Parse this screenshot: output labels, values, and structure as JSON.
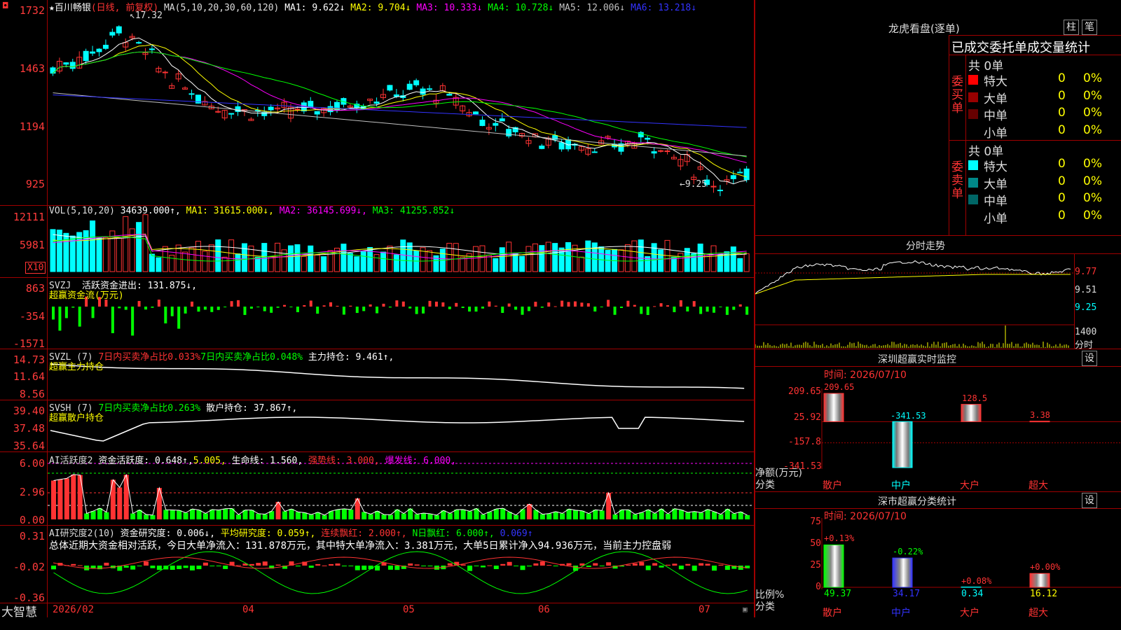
{
  "stock": {
    "star": "★",
    "name": "百川畅银",
    "mode": "(日线, 前复权)"
  },
  "kline": {
    "ma_title": "MA(5,10,20,30,60,120)",
    "ma_items": [
      {
        "label": "MA1: 9.622↓",
        "color": "#ffffff"
      },
      {
        "label": "MA2: 9.704↓",
        "color": "#ffff00"
      },
      {
        "label": "MA3: 10.333↓",
        "color": "#ff00ff"
      },
      {
        "label": "MA4: 10.728↓",
        "color": "#00ff00"
      },
      {
        "label": "MA5: 12.006↓",
        "color": "#c0c0c0"
      },
      {
        "label": "MA6: 13.218↓",
        "color": "#3333ff"
      }
    ],
    "y_labels": [
      "1732",
      "1463",
      "1194",
      "925"
    ],
    "high_mark": "17.32",
    "low_mark": "←9.25",
    "colors": {
      "up": "#ff3333",
      "down": "#00ffff"
    }
  },
  "vol": {
    "title": "VOL(5,10,20)",
    "value": "34639.000↑,",
    "ma1": "MA1: 31615.000↓,",
    "ma2": "MA2: 36145.699↓,",
    "ma3": "MA3: 41255.852↓",
    "y_labels": [
      "12111",
      "5981"
    ],
    "unit": "X10"
  },
  "svzj": {
    "title": "SVZJ",
    "desc": "活跃资金进出: 131.875↓,",
    "sub": "超赢资金流(万元)",
    "y_labels": [
      "863",
      "-354",
      "-1571"
    ]
  },
  "svzl": {
    "title": "SVZL (7)",
    "t1": "7日内买卖净占比0.033%",
    "t2": "7日内买卖净占比0.048%",
    "t3": "主力持仓: 9.461↑,",
    "sub": "超赢主力持仓",
    "y_labels": [
      "14.73",
      "11.64",
      "8.56"
    ]
  },
  "svsh": {
    "title": "SVSH (7)",
    "t1": "7日内买卖净占比0.263%",
    "t2": "散户持仓: 37.867↑,",
    "sub": "超赢散户持仓",
    "y_labels": [
      "39.40",
      "37.48",
      "35.64"
    ]
  },
  "ai1": {
    "title": "AI活跃度2",
    "t1": "资金活跃度: 0.648↑,",
    "t2": "5.005,",
    "t3": "生命线: 1.560,",
    "t4": "强势线: 3.000,",
    "t5": "爆发线: 6.000,",
    "y_labels": [
      "6.00",
      "2.96",
      "0.00"
    ]
  },
  "ai2": {
    "title": "AI研究度2(10)",
    "t1": "资金研究度: 0.006↓,",
    "t2": "平均研究度: 0.059↑,",
    "t3": "连续飘红: 2.000↑,",
    "t4": "N日飘红: 6.000↑,",
    "t5": "0.069↑",
    "summary": "总体近期大资金相对活跃，今日大单净流入：131.878万元，其中特大单净流入：3.381万元，大单5日累计净入94.936万元，当前主力控盘弱",
    "y_labels": [
      "0.31",
      "-0.02",
      "-0.36"
    ]
  },
  "xaxis": {
    "labels": [
      "2026/02",
      "04",
      "05",
      "06",
      "07"
    ],
    "logo": "大智慧"
  },
  "lhb": {
    "title": "龙虎看盘(逐单)",
    "tab1": "柱",
    "tab2": "笔",
    "header": "已成交委托单成交量统计",
    "buy": {
      "side": "委买单",
      "total": "共 0单",
      "rows": [
        {
          "name": "特大",
          "count": "0",
          "pct": "0%",
          "color": "#ff0000"
        },
        {
          "name": "大单",
          "count": "0",
          "pct": "0%",
          "color": "#990000"
        },
        {
          "name": "中单",
          "count": "0",
          "pct": "0%",
          "color": "#660000"
        },
        {
          "name": "小单",
          "count": "0",
          "pct": "0%",
          "color": "#000000"
        }
      ]
    },
    "sell": {
      "side": "委卖单",
      "total": "共 0单",
      "rows": [
        {
          "name": "特大",
          "count": "0",
          "pct": "0%",
          "color": "#00ffff"
        },
        {
          "name": "大单",
          "count": "0",
          "pct": "0%",
          "color": "#008888"
        },
        {
          "name": "中单",
          "count": "0",
          "pct": "0%",
          "color": "#006666"
        },
        {
          "name": "小单",
          "count": "0",
          "pct": "0%",
          "color": "#000000"
        }
      ]
    }
  },
  "fenshi": {
    "title": "分时走势",
    "y_labels": [
      "9.77",
      "9.51",
      "9.25"
    ],
    "vol_label": "1400",
    "unit_label": "分时"
  },
  "monitor": {
    "title": "深圳超赢实时监控",
    "set": "设",
    "time": "时间: 2026/07/10",
    "y_labels": [
      "209.65",
      "25.92",
      "-157.8",
      "-341.53"
    ],
    "unit": "净额(万元)",
    "cat_label": "分类",
    "categories": [
      "散户",
      "中户",
      "大户",
      "超大"
    ],
    "values": [
      209.65,
      -341.53,
      128.5,
      3.38
    ],
    "value_labels": [
      "209.65",
      "-341.53",
      "128.5",
      "3.38"
    ]
  },
  "classify": {
    "title": "深市超赢分类统计",
    "set": "设",
    "time": "时间: 2026/07/10",
    "y_labels": [
      "75",
      "50",
      "25",
      "0"
    ],
    "unit": "比例%",
    "cat_label": "分类",
    "categories": [
      "散户",
      "中户",
      "大户",
      "超大"
    ],
    "pct_labels": [
      "+0.13%",
      "-0.22%",
      "+0.08%",
      "+0.00%"
    ],
    "values": [
      49.37,
      34.17,
      0.34,
      16.12
    ],
    "value_labels": [
      "49.37",
      "34.17",
      "0.34",
      "16.12"
    ]
  }
}
